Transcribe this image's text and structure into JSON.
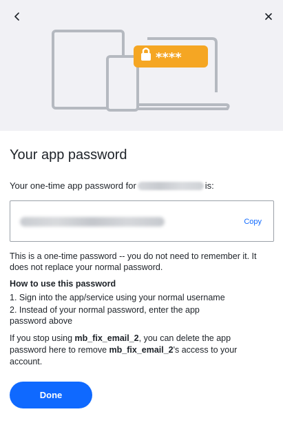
{
  "header": {
    "back_icon": "chevron-left-icon",
    "close_icon": "close-icon",
    "illustration": "devices-password-illustration",
    "password_mask": "****"
  },
  "main": {
    "title": "Your app password",
    "intro_prefix": "Your one-time app password for",
    "intro_suffix": "is:",
    "copy_label": "Copy",
    "note": "This is a one-time password -- you do not need to remember it. It does not replace your normal password.",
    "howto_heading": "How to use this password",
    "step1": "1. Sign into the app/service using your normal username",
    "step2": "2. Instead of your normal password, enter the app password above",
    "stop_part1": "If you stop using ",
    "stop_account1": "mb_fix_email_2",
    "stop_part2": ", you can delete the app password here to remove ",
    "stop_account2": "mb_fix_email_2",
    "stop_part3": "'s access to your account.",
    "done_label": "Done"
  },
  "colors": {
    "accent": "#0f69ff",
    "badge": "#f5a623",
    "hero_bg": "#f1f1f5",
    "device_stroke": "#b5b9c0"
  }
}
